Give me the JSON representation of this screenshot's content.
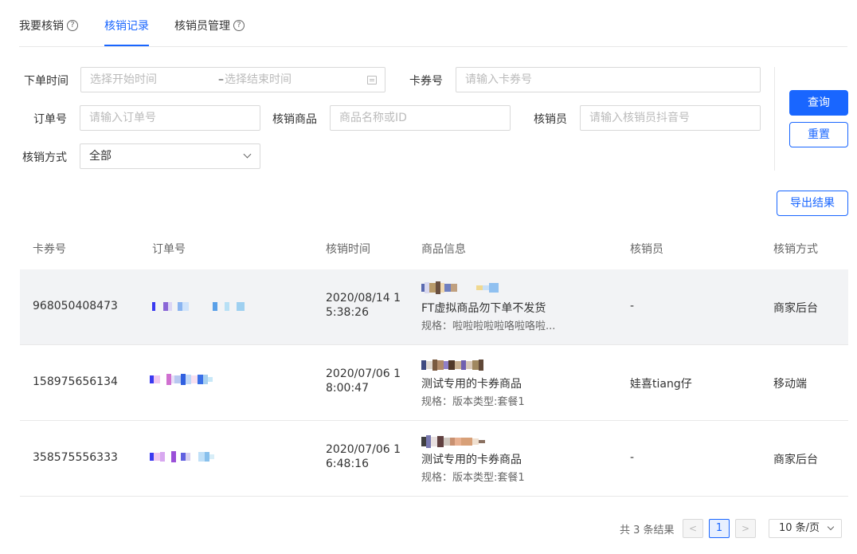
{
  "tabs": [
    {
      "label": "我要核销",
      "help": "?"
    },
    {
      "label": "核销记录"
    },
    {
      "label": "核销员管理",
      "help": "?"
    }
  ],
  "form": {
    "order_time_label": "下单时间",
    "start_placeholder": "选择开始时间",
    "range_sep": "–",
    "end_placeholder": "选择结束时间",
    "coupon_label": "卡券号",
    "coupon_placeholder": "请输入卡券号",
    "order_label": "订单号",
    "order_placeholder": "请输入订单号",
    "product_label": "核销商品",
    "product_placeholder": "商品名称或ID",
    "staff_label": "核销员",
    "staff_placeholder": "请输入核销员抖音号",
    "method_label": "核销方式",
    "method_value": "全部"
  },
  "buttons": {
    "query": "查询",
    "reset": "重置",
    "export": "导出结果"
  },
  "table": {
    "columns": [
      "卡券号",
      "订单号",
      "核销时间",
      "商品信息",
      "核销员",
      "核销方式"
    ],
    "rows": [
      {
        "coupon": "968050408473",
        "time_line1": "2020/08/14 1",
        "time_line2": "5:38:26",
        "product": "FT虚拟商品勿下单不发货",
        "spec": "规格：啦啦啦啦啦咯啦咯啦...",
        "staff": "-",
        "method": "商家后台"
      },
      {
        "coupon": "158975656134",
        "time_line1": "2020/07/06 1",
        "time_line2": "8:00:47",
        "product": "测试专用的卡券商品",
        "spec": "规格：版本类型:套餐1",
        "staff": "娃喜tiang仔",
        "method": "移动端"
      },
      {
        "coupon": "358575556333",
        "time_line1": "2020/07/06 1",
        "time_line2": "6:48:16",
        "product": "测试专用的卡券商品",
        "spec": "规格：版本类型:套餐1",
        "staff": "-",
        "method": "商家后台"
      }
    ]
  },
  "pagination": {
    "total": "共 3 条结果",
    "prev": "<",
    "current": "1",
    "next": ">",
    "page_size": "10 条/页"
  },
  "colors": {
    "accent": "#1966ff",
    "highlight_row": "#f2f3f5"
  }
}
